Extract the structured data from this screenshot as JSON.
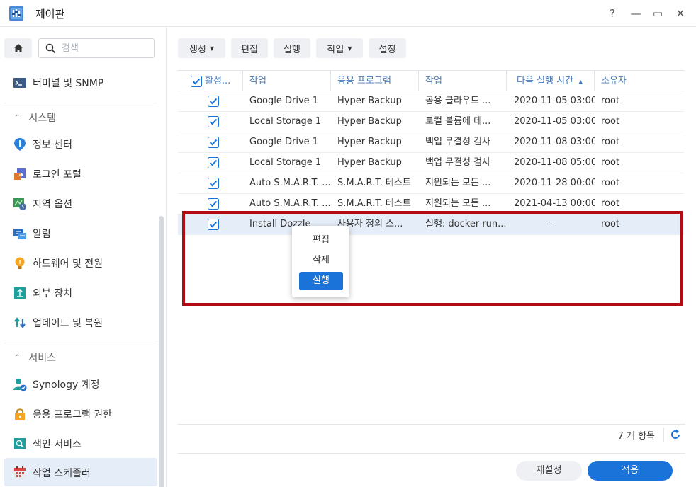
{
  "window": {
    "title": "제어판",
    "help_glyph": "?",
    "minimize_glyph": "—",
    "maximize_glyph": "▭",
    "close_glyph": "✕"
  },
  "sidebar": {
    "search_placeholder": "검색",
    "items": [
      {
        "label": "터미널 및 SNMP",
        "icon": "terminal-icon"
      },
      {
        "group": "시스템"
      },
      {
        "label": "정보 센터",
        "icon": "info-icon"
      },
      {
        "label": "로그인 포털",
        "icon": "login-portal-icon"
      },
      {
        "label": "지역 옵션",
        "icon": "regional-icon"
      },
      {
        "label": "알림",
        "icon": "notification-icon"
      },
      {
        "label": "하드웨어 및 전원",
        "icon": "hardware-icon"
      },
      {
        "label": "외부 장치",
        "icon": "external-device-icon"
      },
      {
        "label": "업데이트 및 복원",
        "icon": "update-icon"
      },
      {
        "group": "서비스"
      },
      {
        "label": "Synology 계정",
        "icon": "account-icon"
      },
      {
        "label": "응용 프로그램 권한",
        "icon": "lock-icon"
      },
      {
        "label": "색인 서비스",
        "icon": "index-icon"
      },
      {
        "label": "작업 스케줄러",
        "icon": "calendar-icon",
        "active": true
      }
    ]
  },
  "toolbar": {
    "create": "생성",
    "edit": "편집",
    "run": "실행",
    "action": "작업",
    "settings": "설정"
  },
  "table": {
    "columns": [
      "활성...",
      "작업",
      "응용 프로그램",
      "작업",
      "다음 실행 시간",
      "소유자"
    ],
    "sort_glyph": "▲",
    "rows": [
      {
        "enabled": true,
        "task": "Google Drive 1",
        "app": "Hyper Backup",
        "action": "공용 클라우드 ...",
        "next": "2020-11-05 03:00",
        "owner": "root"
      },
      {
        "enabled": true,
        "task": "Local Storage 1",
        "app": "Hyper Backup",
        "action": "로컬 볼륨에 데...",
        "next": "2020-11-05 03:00",
        "owner": "root"
      },
      {
        "enabled": true,
        "task": "Google Drive 1",
        "app": "Hyper Backup",
        "action": "백업 무결성 검사",
        "next": "2020-11-08 03:00",
        "owner": "root"
      },
      {
        "enabled": true,
        "task": "Local Storage 1",
        "app": "Hyper Backup",
        "action": "백업 무결성 검사",
        "next": "2020-11-08 05:00",
        "owner": "root"
      },
      {
        "enabled": true,
        "task": "Auto S.M.A.R.T. ...",
        "app": "S.M.A.R.T. 테스트",
        "action": "지원되는 모든 ...",
        "next": "2020-11-28 00:00",
        "owner": "root"
      },
      {
        "enabled": true,
        "task": "Auto S.M.A.R.T. ...",
        "app": "S.M.A.R.T. 테스트",
        "action": "지원되는 모든 ...",
        "next": "2021-04-13 00:00",
        "owner": "root"
      },
      {
        "enabled": true,
        "task": "Install Dozzle",
        "app": "사용자 정의 스...",
        "action": "실행: docker run...",
        "next": "-",
        "owner": "root",
        "selected": true
      }
    ]
  },
  "context_menu": {
    "edit": "편집",
    "delete": "삭제",
    "run": "실행"
  },
  "footer": {
    "count": "7 개 항목",
    "reset": "재설정",
    "apply": "적용"
  },
  "colors": {
    "accent": "#1a73d9",
    "highlight_border": "#b10a12",
    "selected_row": "#e5edf8"
  }
}
